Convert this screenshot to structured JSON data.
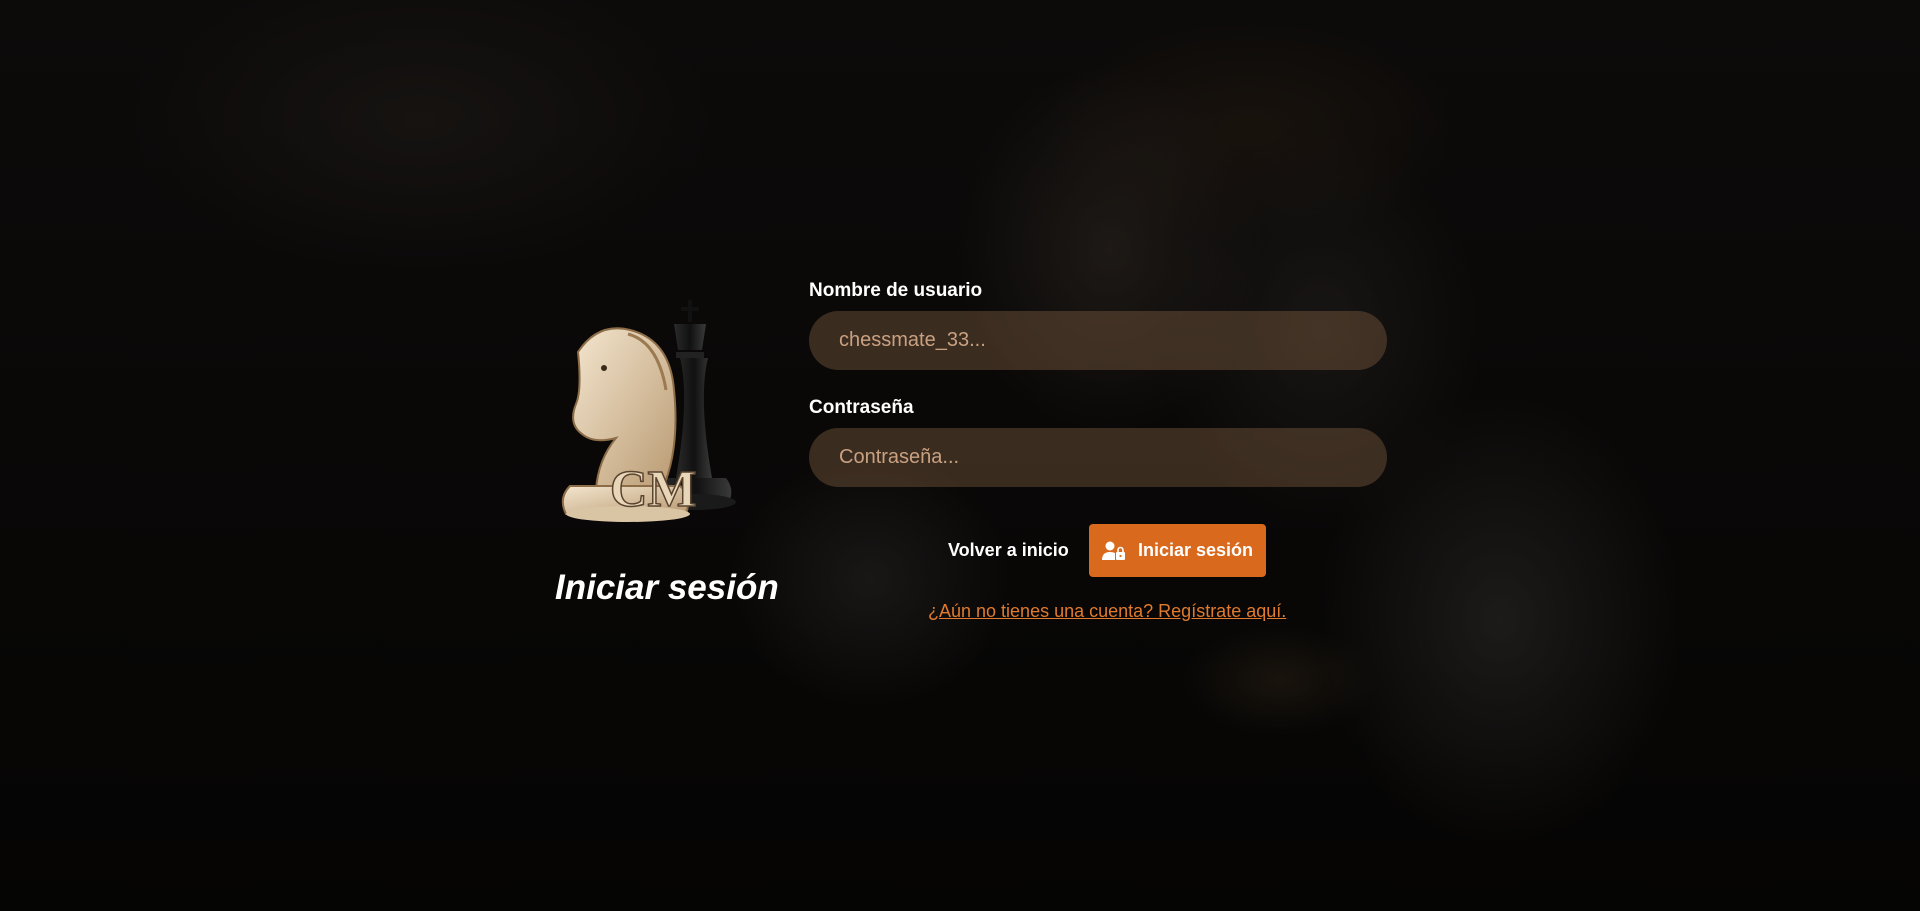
{
  "page": {
    "title": "Iniciar sesión",
    "logo_text": "CM"
  },
  "form": {
    "username": {
      "label": "Nombre de usuario",
      "placeholder": "chessmate_33...",
      "value": ""
    },
    "password": {
      "label": "Contraseña",
      "placeholder": "Contraseña...",
      "value": ""
    }
  },
  "actions": {
    "back_label": "Volver a inicio",
    "login_label": "Iniciar sesión",
    "login_icon": "user-lock-icon",
    "register_link": "¿Aún no tienes una cuenta? Regístrate aquí."
  },
  "colors": {
    "accent": "#d9691c",
    "link": "#e07a2e",
    "input_bg": "#5a4232",
    "text": "#ffffff"
  }
}
